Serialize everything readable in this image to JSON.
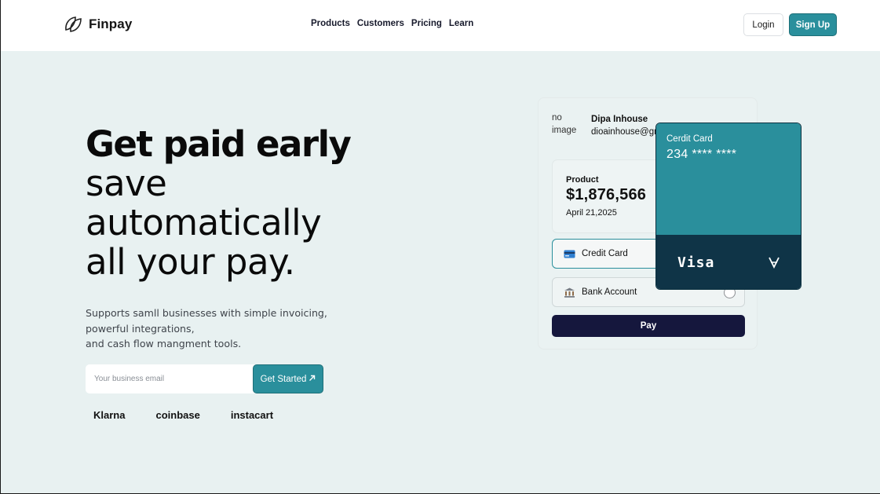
{
  "brand": {
    "name": "Finpay",
    "logo_icon": "double-leaf-logo-icon"
  },
  "nav": {
    "items": [
      "Products",
      "Customers",
      "Pricing",
      "Learn"
    ]
  },
  "header_actions": {
    "login_label": "Login",
    "signup_label": "Sign Up"
  },
  "hero": {
    "headline_bold": "Get paid early",
    "headline_lines": [
      "save",
      "automatically",
      "all your pay."
    ],
    "subtext_lines": [
      "Supports samll businesses with simple invoicing,",
      "powerful integrations,",
      "and cash flow mangment tools."
    ],
    "email_placeholder": "Your business email",
    "cta_label": "Get Started",
    "cta_icon": "arrow-up-right-icon",
    "partners": [
      "Klarna",
      "coinbase",
      "instacart"
    ]
  },
  "payment": {
    "user_image_alt": "no image",
    "user_name": "Dipa Inhouse",
    "user_email": "dioainhouse@gmail.com",
    "product_label": "Product",
    "product_amount": "$1,876,566",
    "product_date": "April 21,2025",
    "options": [
      {
        "label": "Credit Card",
        "icon": "credit-card-icon",
        "selected": true
      },
      {
        "label": "Bank Account",
        "icon": "bank-icon",
        "selected": false
      }
    ],
    "pay_label": "Pay"
  },
  "card": {
    "title": "Cerdit Card",
    "number": "234 **** ****",
    "brand": "Visa",
    "network_icon": "v-mark-icon"
  },
  "colors": {
    "accent": "#2a8f9c",
    "hero_bg": "#e8f1f1",
    "card_dark": "#0f3447",
    "pay_button": "#15173d"
  }
}
